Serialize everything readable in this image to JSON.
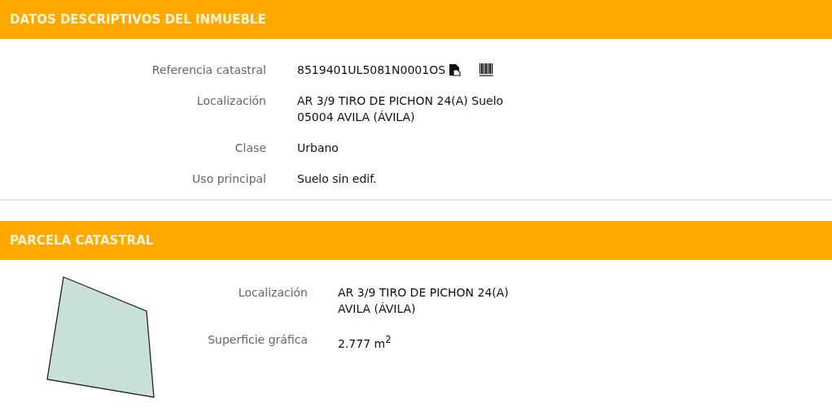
{
  "sections": [
    {
      "title": "DATOS DESCRIPTIVOS DEL INMUEBLE",
      "fields": [
        {
          "label": "Referencia catastral",
          "lines": [
            "8519401UL5081N0001OS"
          ],
          "kind": "reference"
        },
        {
          "label": "Localización",
          "lines": [
            "AR 3/9 TIRO DE PICHON 24(A) Suelo",
            "05004 AVILA (ÁVILA)"
          ],
          "kind": "text"
        },
        {
          "label": "Clase",
          "lines": [
            "Urbano"
          ],
          "kind": "text"
        },
        {
          "label": "Uso principal",
          "lines": [
            "Suelo sin edif."
          ],
          "kind": "text"
        }
      ]
    },
    {
      "title": "PARCELA CATASTRAL",
      "fields": [
        {
          "label": "Localización",
          "lines": [
            "AR 3/9 TIRO DE PICHON 24(A)",
            "AVILA (ÁVILA)"
          ]
        },
        {
          "label": "Superficie gráfica",
          "lines": [
            "2.777 m$^{2}$"
          ]
        }
      ]
    }
  ]
}
